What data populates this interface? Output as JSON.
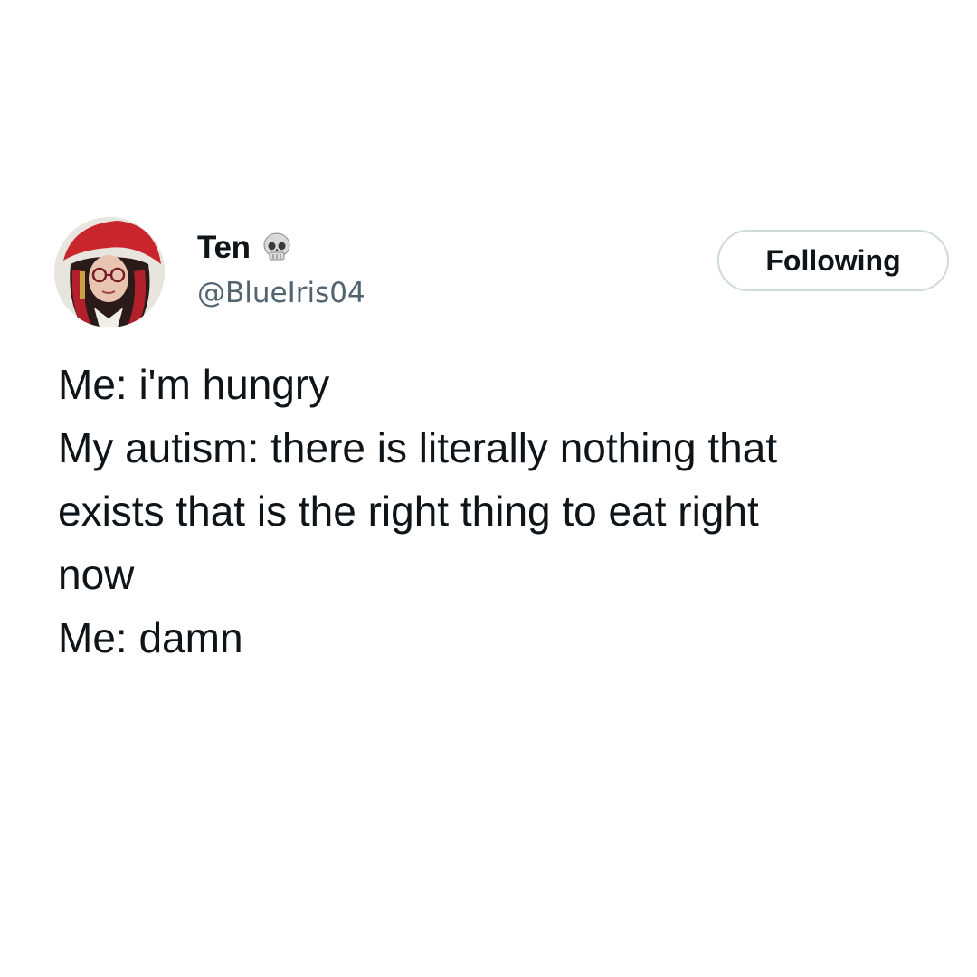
{
  "author": {
    "display_name": "Ten",
    "badge_icon": "skull-icon",
    "handle": "@BlueIris04",
    "avatar": "profile-photo"
  },
  "follow_button": {
    "label": "Following"
  },
  "tweet": {
    "lines": [
      "Me: i'm hungry",
      "My autism: there is literally nothing that",
      "exists that is the right thing to eat right",
      "now",
      "Me: damn"
    ]
  },
  "colors": {
    "text_primary": "#0f1419",
    "text_secondary": "#536471",
    "button_border": "#cfd9de",
    "background": "#ffffff"
  }
}
